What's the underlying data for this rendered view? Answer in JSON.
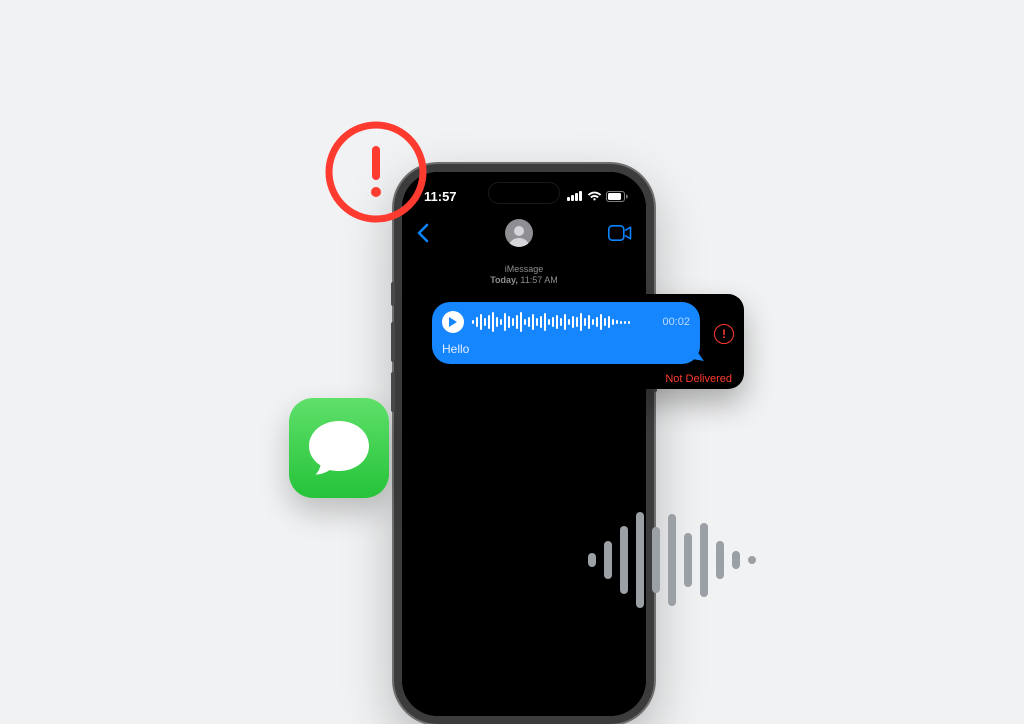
{
  "status": {
    "time": "11:57"
  },
  "conversation": {
    "service_label": "iMessage",
    "date_prefix": "Today,",
    "date_time": "11:57 AM"
  },
  "bubble": {
    "duration": "00:02",
    "caption": "Hello",
    "status": "Not Delivered"
  },
  "icons": {
    "alert": "exclamation-circle",
    "back": "chevron-left",
    "video": "video-camera",
    "avatar": "generic-avatar",
    "play": "play",
    "messages_app": "messages-speech-bubble"
  },
  "colors": {
    "accent_blue": "#1686ff",
    "system_blue": "#0a84ff",
    "error_red": "#ff3b30",
    "app_green": "#25c33a"
  }
}
